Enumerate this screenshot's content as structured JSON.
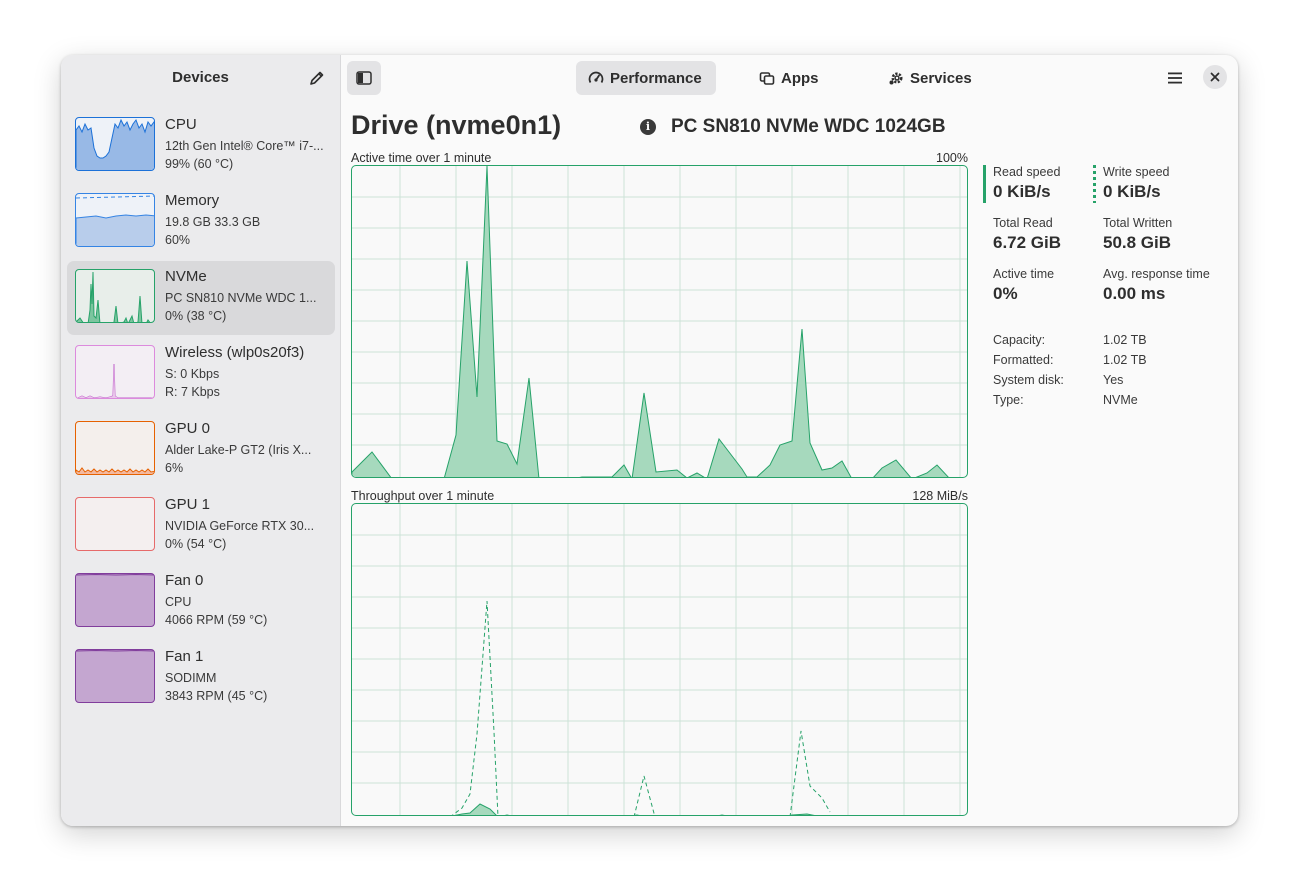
{
  "sidebar": {
    "title": "Devices",
    "devices": [
      {
        "name": "CPU",
        "line1": "12th Gen Intel® Core™ i7-...",
        "line2": "99% (60 °C)",
        "color": "#1c71d8"
      },
      {
        "name": "Memory",
        "line1": "19.8 GB 33.3 GB",
        "line2": "60%",
        "color": "#3584e4"
      },
      {
        "name": "NVMe",
        "line1": "PC SN810 NVMe WDC 1...",
        "line2": "0% (38 °C)",
        "color": "#26a269",
        "selected": true
      },
      {
        "name": "Wireless (wlp0s20f3)",
        "line1": "S: 0 Kbps",
        "line2": "R: 7 Kbps",
        "color": "#c061cb"
      },
      {
        "name": "GPU 0",
        "line1": "Alder Lake-P GT2 (Iris X...",
        "line2": "6%",
        "color": "#e66100"
      },
      {
        "name": "GPU 1",
        "line1": "NVIDIA GeForce RTX 30...",
        "line2": "0% (54 °C)",
        "color": "#e01b24"
      },
      {
        "name": "Fan 0",
        "line1": "CPU",
        "line2": "4066 RPM (59 °C)",
        "color": "#813d9c"
      },
      {
        "name": "Fan 1",
        "line1": "SODIMM",
        "line2": "3843 RPM (45 °C)",
        "color": "#813d9c"
      }
    ]
  },
  "header": {
    "tabs": [
      {
        "label": "Performance",
        "icon": "gauge-icon",
        "active": true
      },
      {
        "label": "Apps",
        "icon": "windows-icon",
        "active": false
      },
      {
        "label": "Services",
        "icon": "gears-icon",
        "active": false
      }
    ]
  },
  "drive": {
    "title": "Drive (nvme0n1)",
    "model": "PC SN810 NVMe WDC 1024GB"
  },
  "graphs": {
    "active": {
      "label": "Active time over 1 minute",
      "max": "100%"
    },
    "throughput": {
      "label": "Throughput over 1 minute",
      "max": "128 MiB/s"
    }
  },
  "stats": {
    "read_speed": {
      "label": "Read speed",
      "value": "0 KiB/s"
    },
    "write_speed": {
      "label": "Write speed",
      "value": "0 KiB/s"
    },
    "total_read": {
      "label": "Total Read",
      "value": "6.72 GiB"
    },
    "total_written": {
      "label": "Total Written",
      "value": "50.8 GiB"
    },
    "active_time": {
      "label": "Active time",
      "value": "0%"
    },
    "avg_response": {
      "label": "Avg. response time",
      "value": "0.00 ms"
    }
  },
  "properties": [
    {
      "key": "Capacity:",
      "value": "1.02 TB"
    },
    {
      "key": "Formatted:",
      "value": "1.02 TB"
    },
    {
      "key": "System disk:",
      "value": "Yes"
    },
    {
      "key": "Type:",
      "value": "NVMe"
    }
  ],
  "colors": {
    "accent_green": "#26a269",
    "fill_green": "#a6d9bd"
  }
}
